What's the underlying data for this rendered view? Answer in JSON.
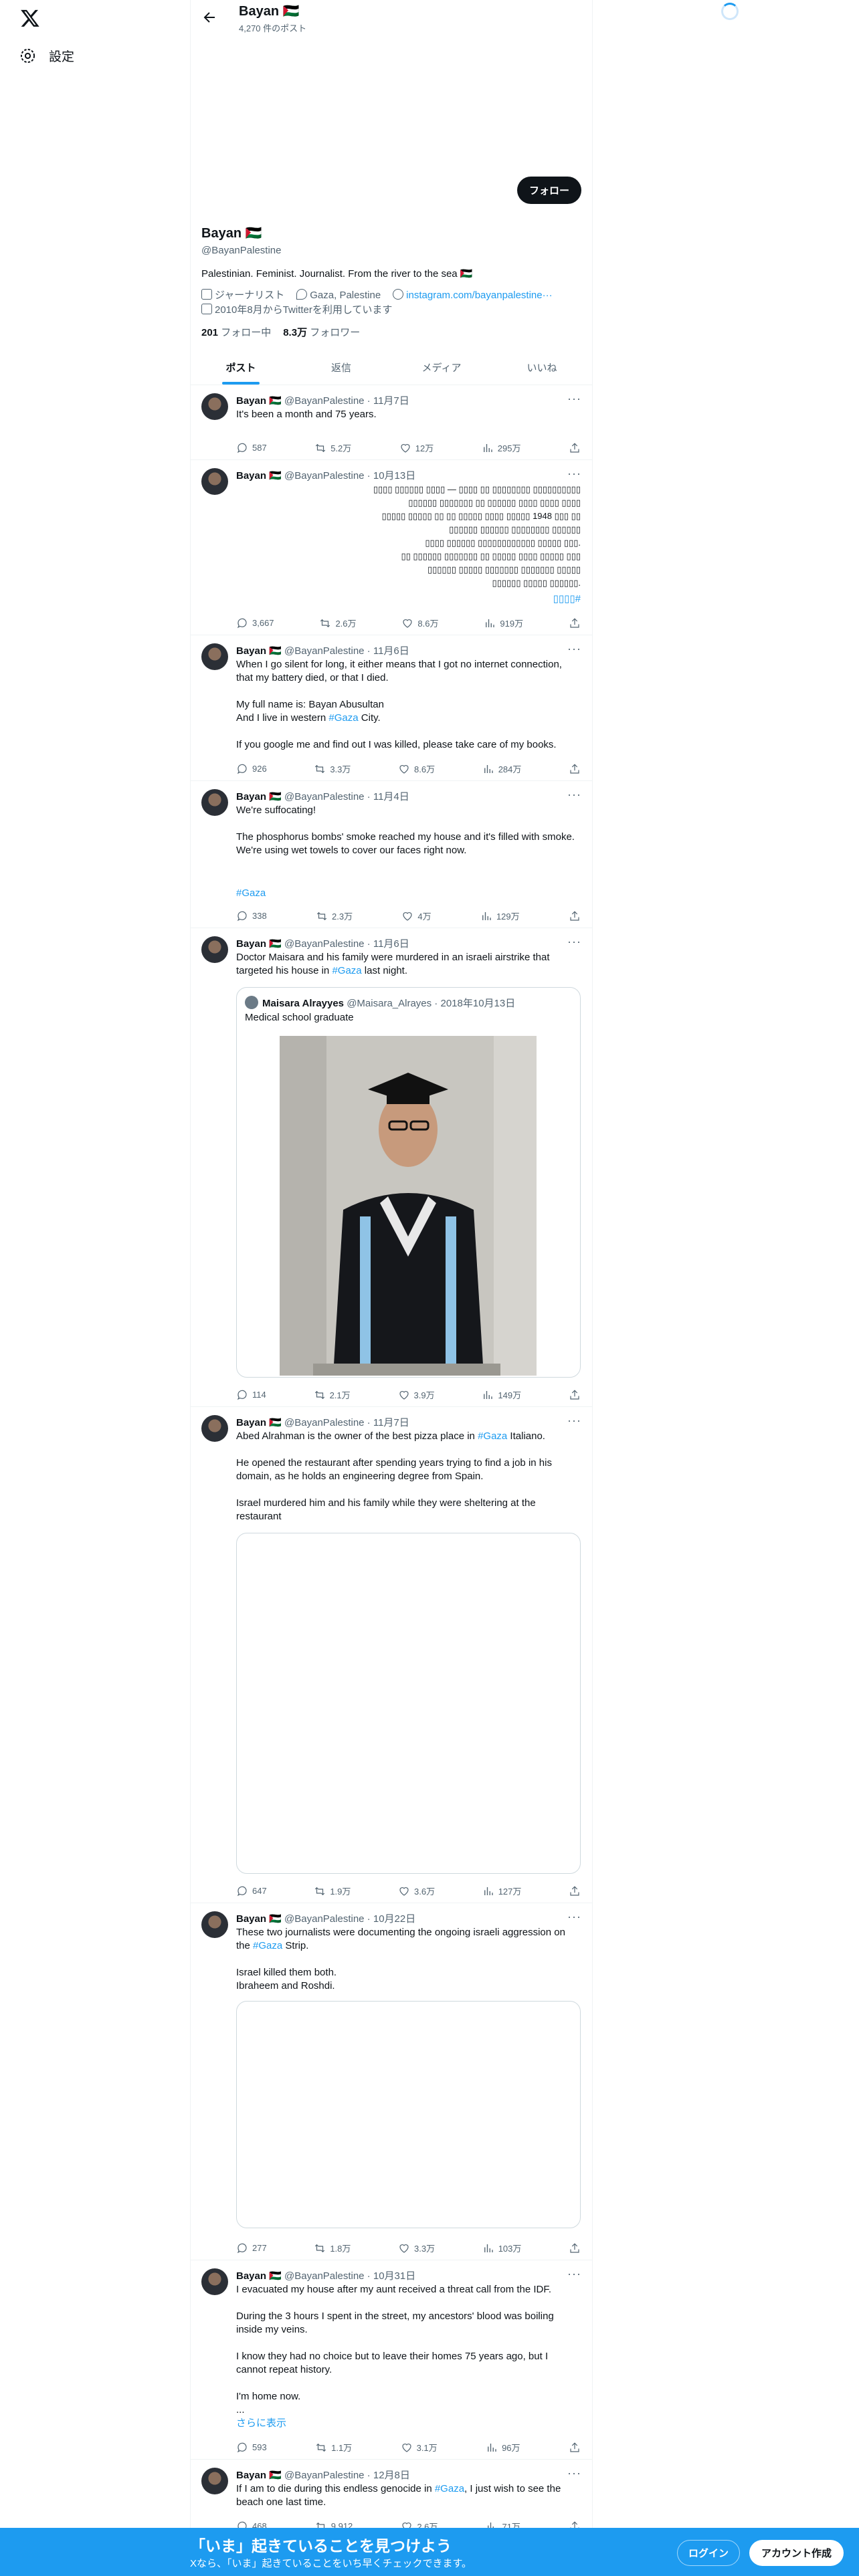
{
  "nav": {
    "settings_label": "設定"
  },
  "header": {
    "name": "Bayan 🇵🇸",
    "post_count": "4,270 件のポスト"
  },
  "profile": {
    "follow_label": "フォロー",
    "name": "Bayan 🇵🇸",
    "handle": "@BayanPalestine",
    "bio": "Palestinian. Feminist. Journalist. From the river to the sea 🇵🇸",
    "occupation": "ジャーナリスト",
    "location": "Gaza, Palestine",
    "link": "instagram.com/bayanpalestine···",
    "joined": "2010年8月からTwitterを利用しています",
    "following_count": "201",
    "following_label": "フォロー中",
    "followers_count": "8.3万",
    "followers_label": "フォロワー"
  },
  "tabs": [
    "ポスト",
    "返信",
    "メディア",
    "いいね"
  ],
  "tweets": [
    {
      "name": "Bayan 🇵🇸",
      "handle": "@BayanPalestine",
      "date": "11月7日",
      "text": "It's been a month and 75 years.",
      "replies": "587",
      "reposts": "5.2万",
      "likes": "12万",
      "views": "295万"
    },
    {
      "name": "Bayan 🇵🇸",
      "handle": "@BayanPalestine",
      "date": "10月13日",
      "text": "▯▯▯▯▯▯▯▯▯▯ ▯▯▯▯▯▯▯▯ ▯▯ ▯▯▯▯ — ▯▯▯▯ ▯▯▯▯▯▯ ▯▯▯▯\n▯▯▯▯ ▯▯▯▯ ▯▯▯▯ ▯▯▯▯▯▯ ▯▯ ▯▯▯▯▯▯▯ ▯▯▯▯▯▯\n▯▯ ▯▯▯ 1948 ▯▯▯▯▯ ▯▯▯▯ ▯▯▯▯▯ ▯▯ ▯▯ ▯▯▯▯▯ ▯▯▯▯▯\n▯▯▯▯▯▯ ▯▯▯▯▯▯▯▯ ▯▯▯▯▯▯ ▯▯▯▯▯▯\n.▯▯▯ ▯▯▯▯▯ ▯▯▯▯▯▯▯▯▯▯▯▯ ▯▯▯▯▯▯ ▯▯▯▯\n▯▯▯ ▯▯▯▯▯ ▯▯▯▯ ▯▯▯▯▯ ▯▯ ▯▯▯▯▯▯▯ ▯▯▯▯▯▯ ▯▯\n▯▯▯▯▯ ▯▯▯▯▯▯▯ ▯▯▯▯▯▯▯ ▯▯▯▯▯ ▯▯▯▯▯▯\n.▯▯▯▯▯▯ ▯▯▯▯▯ ▯▯▯▯▯▯",
      "hashtag": "▯▯▯▯#",
      "replies": "3,667",
      "reposts": "2.6万",
      "likes": "8.6万",
      "views": "919万"
    },
    {
      "name": "Bayan 🇵🇸",
      "handle": "@BayanPalestine",
      "date": "11月6日",
      "text_a": "When I go silent for long, it either means that I got no internet connection, that my battery died, or that I died.\n\nMy full name is: Bayan Abusultan\nAnd I live in western ",
      "hashtag": "#Gaza",
      "text_b": " City.\n\nIf you google me and find out I was killed, please take care of my books.",
      "replies": "926",
      "reposts": "3.3万",
      "likes": "8.6万",
      "views": "284万"
    },
    {
      "name": "Bayan 🇵🇸",
      "handle": "@BayanPalestine",
      "date": "11月4日",
      "text": "We're suffocating!\n\nThe phosphorus bombs' smoke reached my house and it's filled with smoke.\nWe're using wet towels to cover our faces right now.",
      "hashtag": "#Gaza",
      "replies": "338",
      "reposts": "2.3万",
      "likes": "4万",
      "views": "129万"
    },
    {
      "name": "Bayan 🇵🇸",
      "handle": "@BayanPalestine",
      "date": "11月6日",
      "text_a": "Doctor Maisara and his family were murdered in an israeli airstrike that targeted his house in ",
      "hashtag": "#Gaza",
      "text_b": " last night.",
      "quote": {
        "name": "Maisara Alrayyes",
        "handle": "@Maisara_Alrayes",
        "date": "2018年10月13日",
        "text": "Medical school graduate"
      },
      "replies": "114",
      "reposts": "2.1万",
      "likes": "3.9万",
      "views": "149万"
    },
    {
      "name": "Bayan 🇵🇸",
      "handle": "@BayanPalestine",
      "date": "11月7日",
      "text_a": "Abed Alrahman is the owner of the best pizza place in ",
      "hashtag": "#Gaza",
      "text_b": " Italiano.\n\nHe opened the restaurant after spending years trying to find a job in his domain, as he holds an engineering degree from Spain.\n\nIsrael murdered him and his family while they were sheltering at the restaurant",
      "replies": "647",
      "reposts": "1.9万",
      "likes": "3.6万",
      "views": "127万"
    },
    {
      "name": "Bayan 🇵🇸",
      "handle": "@BayanPalestine",
      "date": "10月22日",
      "text_a": "These two journalists were documenting the ongoing israeli aggression on the ",
      "hashtag": "#Gaza",
      "text_b": " Strip.\n\nIsrael killed them both.\nIbraheem and Roshdi.",
      "replies": "277",
      "reposts": "1.8万",
      "likes": "3.3万",
      "views": "103万"
    },
    {
      "name": "Bayan 🇵🇸",
      "handle": "@BayanPalestine",
      "date": "10月31日",
      "text": "I evacuated my house after my aunt received a threat call from the IDF.\n\nDuring the 3 hours I spent in the street, my ancestors' blood was boiling inside my veins.\n\nI know they had no choice but to leave their homes 75 years ago, but I cannot repeat history.\n\nI'm home now.\n...",
      "show_more": "さらに表示",
      "replies": "593",
      "reposts": "1.1万",
      "likes": "3.1万",
      "views": "96万"
    },
    {
      "name": "Bayan 🇵🇸",
      "handle": "@BayanPalestine",
      "date": "12月8日",
      "text_a": "If I am to die during this endless genocide in ",
      "hashtag": "#Gaza",
      "text_b": ", I just wish to see the beach one last time.",
      "replies": "468",
      "reposts": "9,912",
      "likes": "2.6万",
      "views": "71万"
    }
  ],
  "bottom_bar": {
    "title": "「いま」起きていることを見つけよう",
    "subtitle": "Xなら、「いま」起きていることをいち早くチェックできます。",
    "login_label": "ログイン",
    "signup_label": "アカウント作成"
  }
}
